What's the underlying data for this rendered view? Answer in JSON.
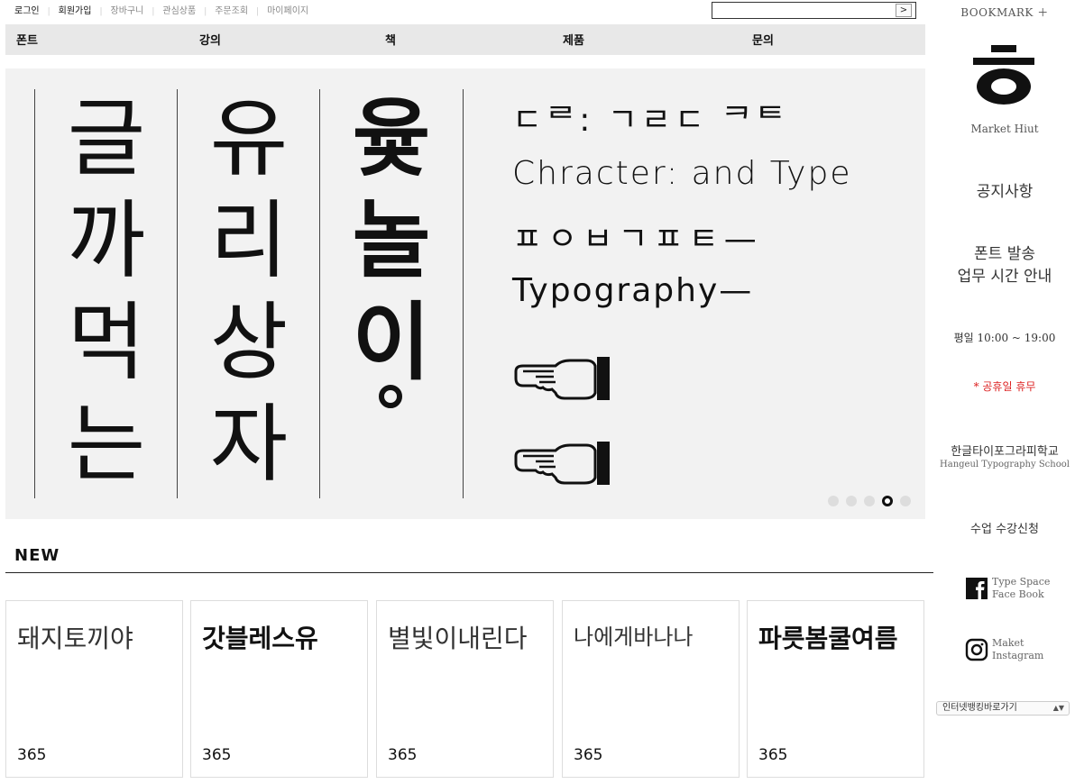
{
  "util_links": [
    {
      "label": "로그인",
      "strong": true
    },
    {
      "label": "회원가입",
      "strong": true
    },
    {
      "label": "장바구니",
      "strong": false
    },
    {
      "label": "관심상품",
      "strong": false
    },
    {
      "label": "주문조회",
      "strong": false
    },
    {
      "label": "마이페이지",
      "strong": false
    }
  ],
  "search": {
    "value": "",
    "button_label": ">"
  },
  "nav": [
    "폰트",
    "강의",
    "책",
    "제품",
    "문의"
  ],
  "hero": {
    "columns": [
      [
        "글",
        "까",
        "먹",
        "는"
      ],
      [
        "유",
        "리",
        "상",
        "자"
      ],
      [
        "윷",
        "놀",
        "이",
        ""
      ]
    ],
    "lines": [
      "ㄷᄅ: ㄱㄹㄷ ᄏᄐ",
      "Chracter: and Type",
      "ㅍㅇㅂㄱㅍㅌ—",
      "Typography—"
    ],
    "slide_count": 5,
    "active_slide": 4
  },
  "new_section": {
    "title": "NEW",
    "cards": [
      {
        "name": "돼지토끼야",
        "number": "365",
        "style": "thin"
      },
      {
        "name": "갓블레스유",
        "number": "365",
        "style": "bold"
      },
      {
        "name": "별빛이내린다",
        "number": "365",
        "style": "thin"
      },
      {
        "name": "나에게바나나",
        "number": "365",
        "style": "thin"
      },
      {
        "name": "파릇봄쿨여름",
        "number": "365",
        "style": "bold"
      }
    ]
  },
  "sidebar": {
    "bookmark": "BOOKMARK ＋",
    "logo_glyph": "ㅎ",
    "logo_text": "Market Hiut",
    "notice": "공지사항",
    "shipping_line1": "폰트 발송",
    "shipping_line2": "업무 시간 안내",
    "hours": "평일 10:00 ~ 19:00",
    "holiday": "* 공휴일 휴무",
    "school_kr": "한글타이포그라피학교",
    "school_en": "Hangeul Typography School",
    "enroll": "수업 수강신청",
    "facebook_line1": "Type Space",
    "facebook_line2": "Face Book",
    "instagram_line1": "Maket",
    "instagram_line2": "Instagram",
    "bank_select": "인터넷뱅킹바로가기"
  },
  "colors": {
    "nav_bg": "#e8e8e8",
    "hero_bg": "#f2f2f2",
    "holiday_red": "#dd2222"
  },
  "icons": [
    "search-arrow-icon",
    "pointing-hand-icon",
    "facebook-icon",
    "instagram-icon",
    "select-arrow-icon"
  ]
}
